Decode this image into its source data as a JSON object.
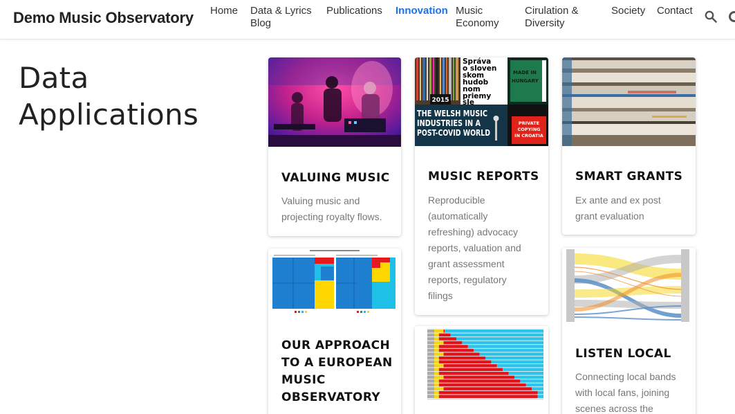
{
  "header": {
    "brand": "Demo Music Observatory",
    "nav": [
      {
        "label": "Home",
        "active": false
      },
      {
        "label": "Data & Lyrics Blog",
        "line1": "Data & Lyrics",
        "line2": "Blog",
        "active": false
      },
      {
        "label": "Publications",
        "active": false
      },
      {
        "label": "Innovation",
        "active": true
      },
      {
        "label": "Music Economy",
        "line1": "Music",
        "line2": "Economy",
        "active": false
      },
      {
        "label": "Cirulation & Diversity",
        "line1": "Cirulation &",
        "line2": "Diversity",
        "active": false
      },
      {
        "label": "Society",
        "active": false
      },
      {
        "label": "Contact",
        "active": false
      }
    ],
    "search_icon": "search-icon",
    "accent_color": "#1a73e8"
  },
  "page": {
    "title_line1": "Data",
    "title_line2": "Applications"
  },
  "cards": {
    "valuing_music": {
      "title": "VALUING MUSIC",
      "desc_line1": "Valuing music and",
      "desc_line2": "projecting royalty flows."
    },
    "music_reports": {
      "title": "MUSIC REPORTS",
      "desc_lines": [
        "Reproducible",
        "(automatically",
        "refreshing) advocacy",
        "reports, valuation and",
        "grant assessment",
        "reports, regulatory",
        "filings"
      ],
      "image_text": {
        "year": "2015",
        "slovak_1": "Správa",
        "slovak_2": "o sloven",
        "slovak_3": "skom",
        "slovak_4": "hudob",
        "slovak_5": "nom",
        "slovak_6": "priemy",
        "slovak_7": "sle",
        "made_in": "MADE IN",
        "hungary": "HUNGARY",
        "welsh_1": "THE WELSH MUSIC",
        "welsh_2": "INDUSTRIES IN A",
        "welsh_3": "POST-COVID WORLD",
        "private_1": "PRIVATE",
        "private_2": "COPYING",
        "private_3": "IN CROATIA"
      }
    },
    "smart_grants": {
      "title": "SMART GRANTS",
      "desc_line1": "Ex ante and ex post",
      "desc_line2": "grant evaluation"
    },
    "european_approach": {
      "title_lines": [
        "OUR APPROACH",
        "TO A EUROPEAN",
        "MUSIC",
        "OBSERVATORY"
      ]
    },
    "listen_local": {
      "title": "LISTEN LOCAL",
      "desc_lines": [
        "Connecting local bands",
        "with local fans, joining",
        "scenes across the"
      ]
    }
  },
  "colors": {
    "treemap_blue": "#1f7fd0",
    "treemap_red": "#e41a1c",
    "treemap_yellow": "#ffd700",
    "treemap_cyan": "#1ec0e8",
    "bar_red": "#e0141a",
    "bar_cyan": "#2cc4ea",
    "bar_yellow": "#f5d617",
    "bar_grey": "#a9a9a9"
  }
}
